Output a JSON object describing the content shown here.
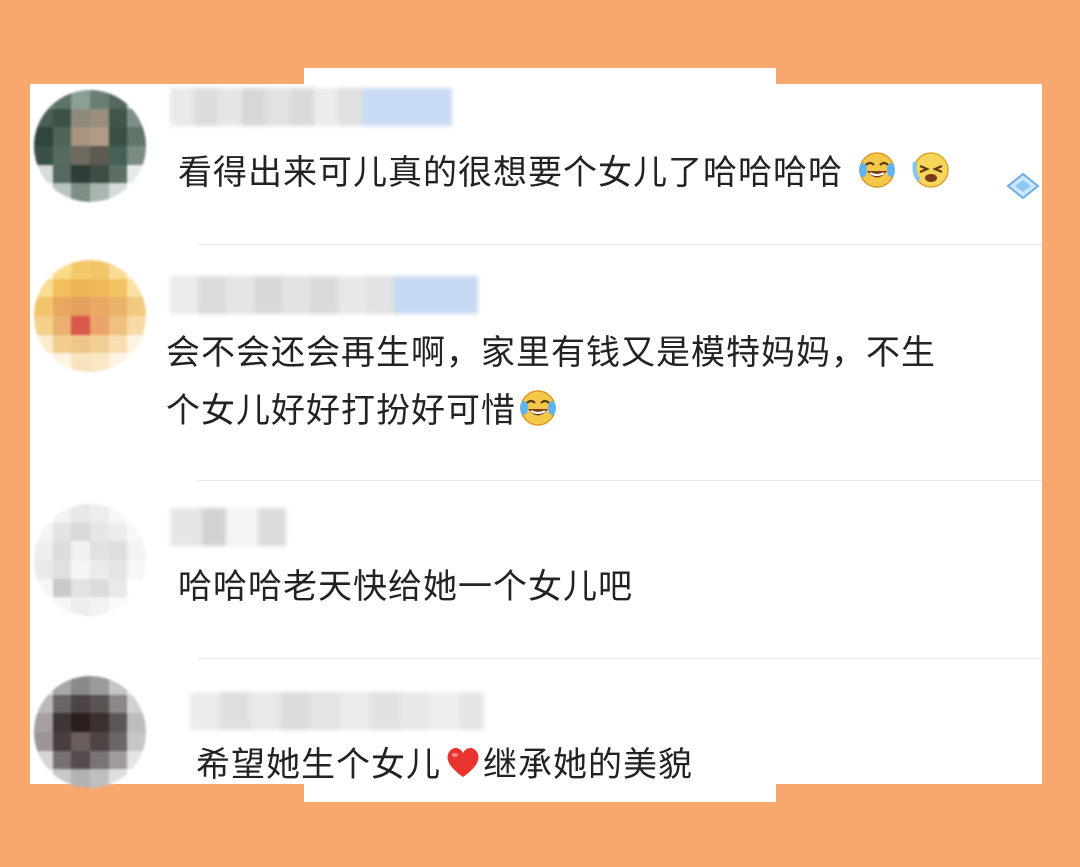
{
  "comments": [
    {
      "username": "",
      "text": "看得出来可儿真的很想要个女儿了哈哈哈哈",
      "emojis": [
        "laugh-cry-icon",
        "tears-icon"
      ]
    },
    {
      "username": "",
      "text_line1": "会不会还会再生啊，家里有钱又是模特妈妈，不生",
      "text_line2": "个女儿好好打扮好可惜",
      "emojis": [
        "laugh-cry-icon"
      ]
    },
    {
      "username": "",
      "text": "哈哈哈老天快给她一个女儿吧"
    },
    {
      "username": "",
      "text_before": "希望她生个女儿",
      "text_after": "继承她的美貌",
      "emojis": [
        "heart-icon"
      ]
    }
  ],
  "colors": {
    "background": "#f8a86f",
    "panel": "#ffffff",
    "text": "#222222",
    "divider": "#e7e7e7",
    "heart": "#e8332f"
  }
}
